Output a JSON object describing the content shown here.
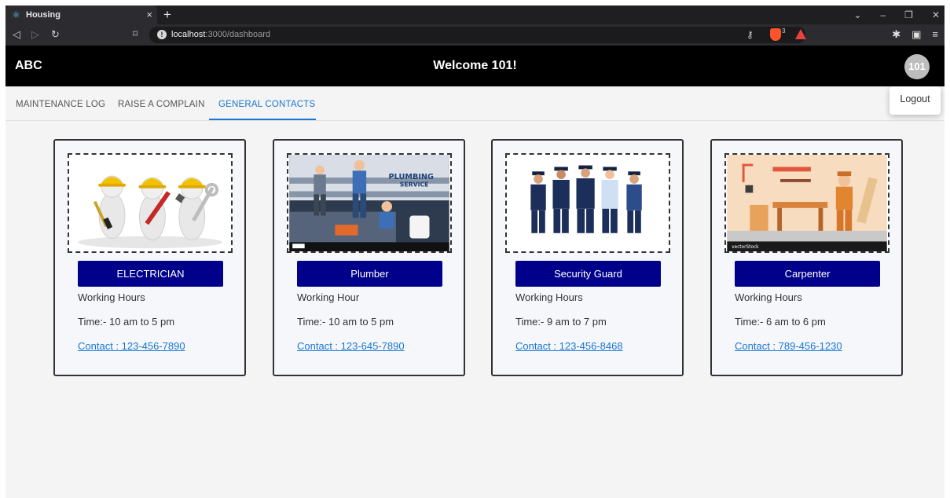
{
  "browser": {
    "tab_title": "Housing",
    "tab_close": "×",
    "new_tab": "+",
    "url_host": "localhost",
    "url_path": ":3000/dashboard",
    "brave_badge": "3"
  },
  "header": {
    "brand": "ABC",
    "welcome": "Welcome 101!",
    "avatar": "101"
  },
  "menu": {
    "logout": "Logout"
  },
  "tabs": [
    {
      "label": "MAINTENANCE LOG"
    },
    {
      "label": "RAISE A COMPLAIN"
    },
    {
      "label": "GENERAL CONTACTS"
    }
  ],
  "active_tab": "GENERAL CONTACTS",
  "cards": [
    {
      "button": "ELECTRICIAN",
      "hours": "Working Hours",
      "time": "Time:- 10 am to 5 pm",
      "contact": "Contact : 123-456-7890"
    },
    {
      "button": "Plumber",
      "hours": "Working Hour",
      "time": "Time:- 10 am to 5 pm",
      "contact": "Contact : 123-645-7890"
    },
    {
      "button": "Security Guard",
      "hours": "Working Hours",
      "time": "Time:- 9 am to 7 pm",
      "contact": "Contact : 123-456-8468"
    },
    {
      "button": "Carpenter",
      "hours": "Working Hours",
      "time": "Time:- 6 am to 6 pm",
      "contact": "Contact : 789-456-1230"
    }
  ],
  "images": {
    "plumbing_title": "PLUMBING",
    "plumbing_sub": "SERVICE",
    "carpenter_mark": "vectorStock"
  },
  "colors": {
    "accent": "#1976d2",
    "button": "#00008b",
    "header_bg": "#000000"
  }
}
